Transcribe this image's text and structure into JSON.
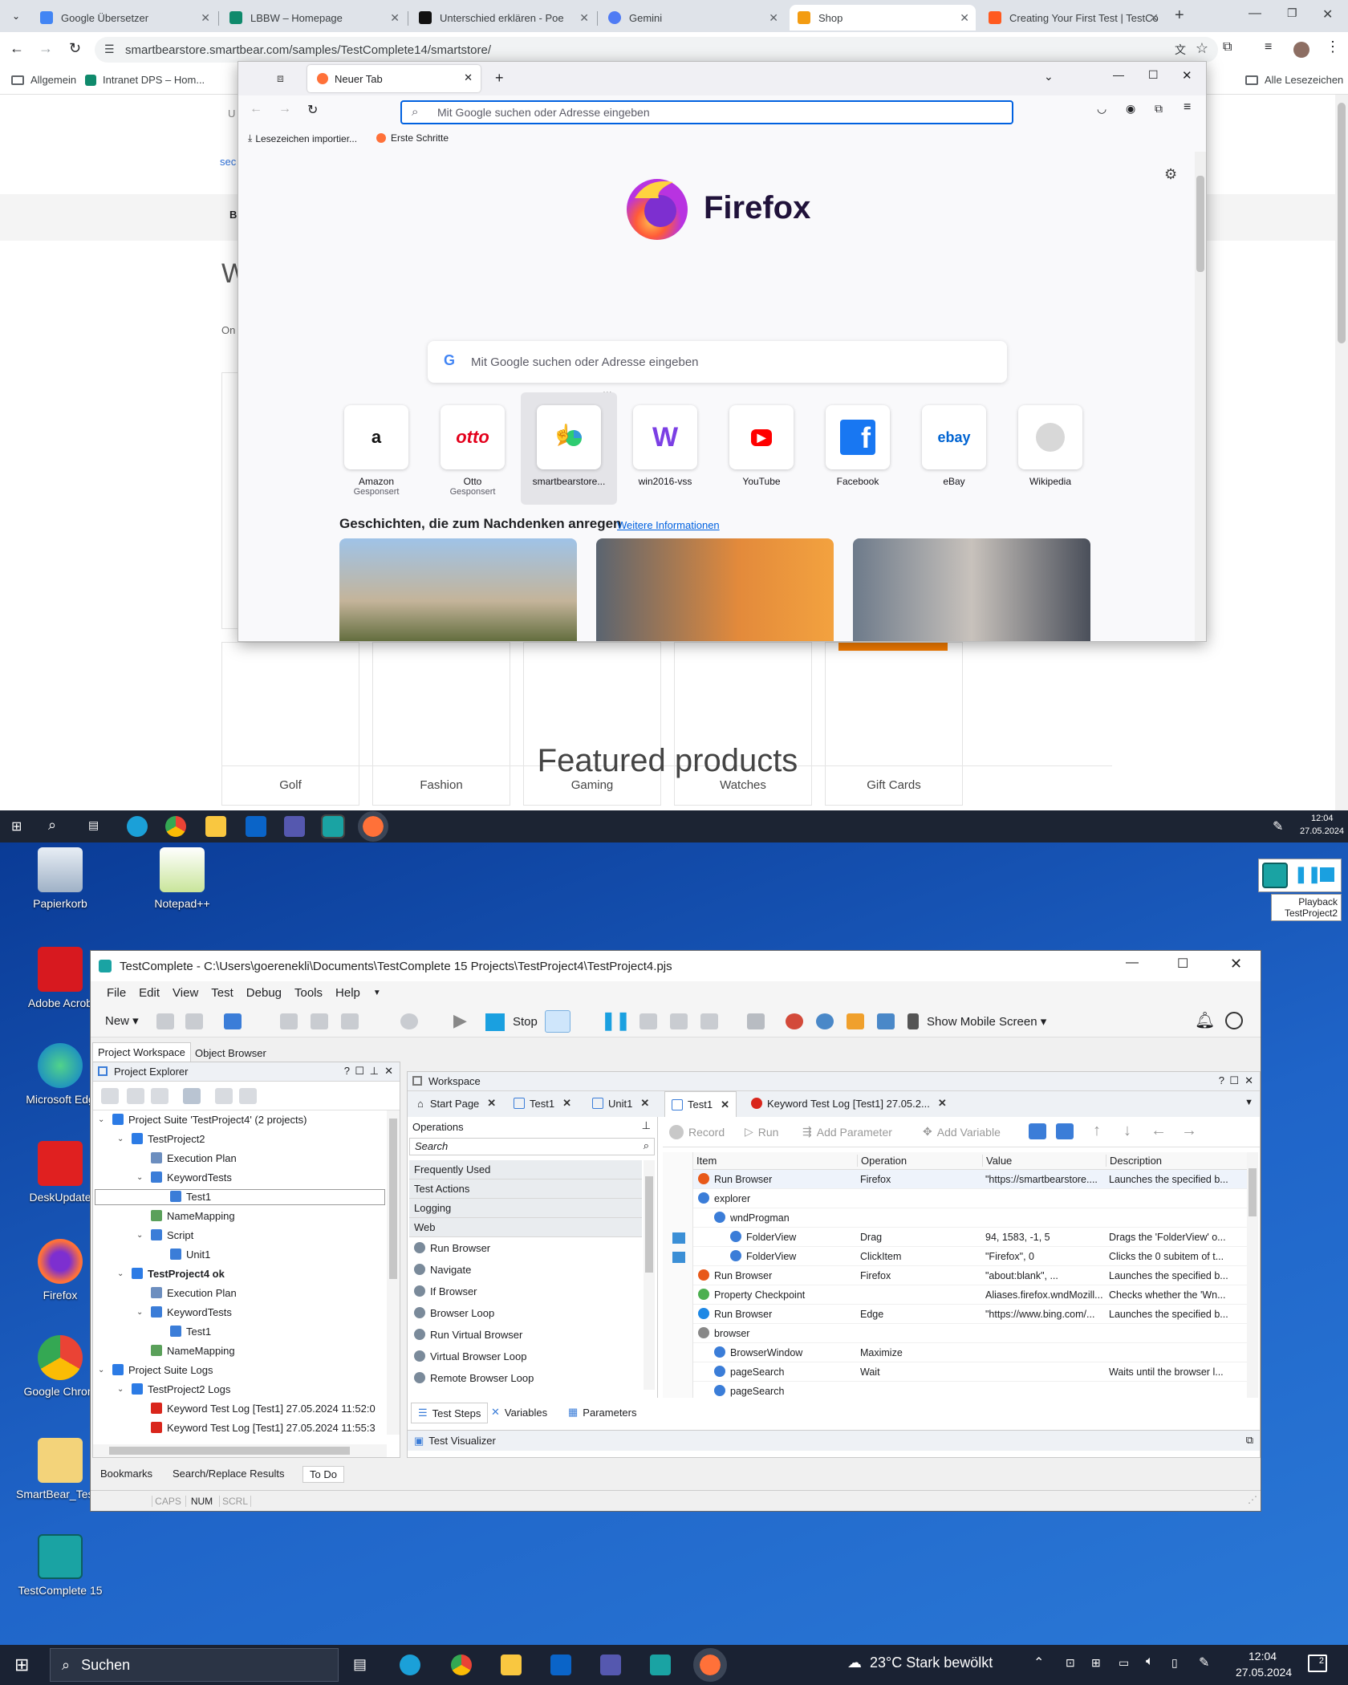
{
  "chrome": {
    "tabs": [
      {
        "label": "Google Übersetzer",
        "color": "#4285f4"
      },
      {
        "label": "LBBW – Homepage",
        "color": "#0f8a6c"
      },
      {
        "label": "Unterschied erklären - Poe",
        "color": "#111111"
      },
      {
        "label": "Gemini",
        "color": "#4f7bf4"
      },
      {
        "label": "Shop",
        "color": "#f39c12"
      },
      {
        "label": "Creating Your First Test | TestCo",
        "color": "#ff5a1f"
      }
    ],
    "url": "smartbearstore.smartbear.com/samples/TestComplete14/smartstore/",
    "bookmarks": [
      "Allgemein",
      "Intranet DPS – Hom..."
    ],
    "all_bookmarks": "Alle Lesezeichen"
  },
  "shop": {
    "partial_left": [
      "U",
      "sec",
      "B",
      "W",
      "On"
    ],
    "categories": [
      "Golf",
      "Fashion",
      "Gaming",
      "Watches",
      "Gift Cards"
    ],
    "featured": "Featured products"
  },
  "firefox": {
    "tab_label": "Neuer Tab",
    "address_placeholder": "Mit Google suchen oder Adresse eingeben",
    "bookmarks": [
      "Lesezeichen importier...",
      "Erste Schritte"
    ],
    "brand": "Firefox",
    "search_placeholder": "Mit Google suchen oder Adresse eingeben",
    "top_sites": [
      {
        "label": "Amazon",
        "sub": "Gesponsert",
        "glyph": "a",
        "color": "#111111"
      },
      {
        "label": "Otto",
        "sub": "Gesponsert",
        "glyph": "otto",
        "color": "#e3001b"
      },
      {
        "label": "smartbearstore...",
        "sub": "",
        "glyph": "",
        "color": "#f39c12"
      },
      {
        "label": "win2016-vss",
        "sub": "",
        "glyph": "W",
        "color": "#7b3fe4"
      },
      {
        "label": "YouTube",
        "sub": "",
        "glyph": "▶",
        "color": "#ff0000"
      },
      {
        "label": "Facebook",
        "sub": "",
        "glyph": "f",
        "color": "#1877f2"
      },
      {
        "label": "eBay",
        "sub": "",
        "glyph": "ebay",
        "color": "#0064d2"
      },
      {
        "label": "Wikipedia",
        "sub": "",
        "glyph": "W",
        "color": "#777777"
      }
    ],
    "stories_title": "Geschichten, die zum Nachdenken anregen",
    "stories_link": "Weitere Informationen",
    "menu_dots": "..."
  },
  "top_taskbar": {
    "time": "12:04",
    "date": "27.05.2024"
  },
  "desktop_icons": [
    "Papierkorb",
    "Notepad++",
    "Adobe Acrob",
    "Microsoft Edg",
    "DeskUpdate",
    "Firefox",
    "Google Chrom",
    "SmartBear_TestC",
    "TestComplete 15"
  ],
  "playback": {
    "line1": "Playback",
    "line2": "TestProject2"
  },
  "tc": {
    "title": "TestComplete - C:\\Users\\goerenekli\\Documents\\TestComplete 15 Projects\\TestProject4\\TestProject4.pjs",
    "menu": [
      "File",
      "Edit",
      "View",
      "Test",
      "Debug",
      "Tools",
      "Help"
    ],
    "toolbar": {
      "new": "New",
      "stop": "Stop",
      "mobile": "Show Mobile Screen"
    },
    "left_tabs": [
      "Project Workspace",
      "Object Browser"
    ],
    "explorer_title": "Project Explorer",
    "tree": [
      {
        "text": "Project Suite 'TestProject4' (2 projects)",
        "level": 0,
        "bold": false,
        "color": "#2c7be5"
      },
      {
        "text": "TestProject2",
        "level": 1,
        "bold": false,
        "color": "#2c7be5"
      },
      {
        "text": "Execution Plan",
        "level": 2,
        "bold": false,
        "color": "#6c8ebf"
      },
      {
        "text": "KeywordTests",
        "level": 2,
        "bold": false,
        "color": "#3b7dd8"
      },
      {
        "text": "Test1",
        "level": 3,
        "bold": false,
        "color": "#3b7dd8"
      },
      {
        "text": "NameMapping",
        "level": 2,
        "bold": false,
        "color": "#5aa05a"
      },
      {
        "text": "Script",
        "level": 2,
        "bold": false,
        "color": "#3b7dd8"
      },
      {
        "text": "Unit1",
        "level": 3,
        "bold": false,
        "color": "#3b7dd8"
      },
      {
        "text": "TestProject4 ok",
        "level": 1,
        "bold": true,
        "color": "#2c7be5"
      },
      {
        "text": "Execution Plan",
        "level": 2,
        "bold": false,
        "color": "#6c8ebf"
      },
      {
        "text": "KeywordTests",
        "level": 2,
        "bold": false,
        "color": "#3b7dd8"
      },
      {
        "text": "Test1",
        "level": 3,
        "bold": false,
        "color": "#3b7dd8"
      },
      {
        "text": "NameMapping",
        "level": 2,
        "bold": false,
        "color": "#5aa05a"
      },
      {
        "text": "Project Suite Logs",
        "level": 0,
        "bold": false,
        "color": "#2c7be5"
      },
      {
        "text": "TestProject2 Logs",
        "level": 1,
        "bold": false,
        "color": "#2c7be5"
      },
      {
        "text": "Keyword Test Log [Test1] 27.05.2024 11:52:0",
        "level": 2,
        "bold": false,
        "color": "#d9261c"
      },
      {
        "text": "Keyword Test Log [Test1] 27.05.2024 11:55:3",
        "level": 2,
        "bold": false,
        "color": "#d9261c"
      }
    ],
    "workspace_title": "Workspace",
    "workspace_tabs": [
      "Start Page",
      "Test1",
      "Unit1",
      "Test1",
      "Keyword Test Log [Test1] 27.05.2..."
    ],
    "operations_title": "Operations",
    "operations_search": "Search",
    "operations_sections": [
      "Frequently Used",
      "Test Actions",
      "Logging",
      "Web"
    ],
    "operations_items": [
      "Run Browser",
      "Navigate",
      "If Browser",
      "Browser Loop",
      "Run Virtual Browser",
      "Virtual Browser Loop",
      "Remote Browser Loop"
    ],
    "kw_toolbar": [
      "Record",
      "Run",
      "Add Parameter",
      "Add Variable"
    ],
    "grid_headers": [
      "Item",
      "Operation",
      "Value",
      "Description"
    ],
    "grid_rows": [
      {
        "item": "Run Browser",
        "level": 0,
        "op": "Firefox",
        "value": "\"https://smartbearstore....",
        "desc": "Launches the specified b...",
        "color": "#e8591a"
      },
      {
        "item": "explorer",
        "level": 0,
        "op": "",
        "value": "",
        "desc": "",
        "color": "#3b7dd8"
      },
      {
        "item": "wndProgman",
        "level": 1,
        "op": "",
        "value": "",
        "desc": "",
        "color": "#3b7dd8"
      },
      {
        "item": "FolderView",
        "level": 2,
        "op": "Drag",
        "value": "94, 1583, -1, 5",
        "desc": "Drags the 'FolderView' o...",
        "color": "#3b7dd8"
      },
      {
        "item": "FolderView",
        "level": 2,
        "op": "ClickItem",
        "value": "\"Firefox\", 0",
        "desc": "Clicks the 0 subitem of t...",
        "color": "#3b7dd8"
      },
      {
        "item": "Run Browser",
        "level": 0,
        "op": "Firefox",
        "value": "\"about:blank\", ...",
        "desc": "Launches the specified b...",
        "color": "#e8591a"
      },
      {
        "item": "Property Checkpoint",
        "level": 0,
        "op": "",
        "value": "Aliases.firefox.wndMozill...",
        "desc": "Checks whether the 'Wn...",
        "color": "#4caf50"
      },
      {
        "item": "Run Browser",
        "level": 0,
        "op": "Edge",
        "value": "\"https://www.bing.com/...",
        "desc": "Launches the specified b...",
        "color": "#1e88e5"
      },
      {
        "item": "browser",
        "level": 0,
        "op": "",
        "value": "",
        "desc": "",
        "color": "#888888"
      },
      {
        "item": "BrowserWindow",
        "level": 1,
        "op": "Maximize",
        "value": "",
        "desc": "",
        "color": "#3b7dd8"
      },
      {
        "item": "pageSearch",
        "level": 1,
        "op": "Wait",
        "value": "",
        "desc": "Waits until the browser l...",
        "color": "#3b7dd8"
      },
      {
        "item": "pageSearch",
        "level": 1,
        "op": "",
        "value": "",
        "desc": "",
        "color": "#3b7dd8"
      }
    ],
    "bottom_tabs": [
      "Test Steps",
      "Variables",
      "Parameters"
    ],
    "visualizer": "Test Visualizer",
    "footer_tabs": [
      "Bookmarks",
      "Search/Replace Results",
      "To Do"
    ],
    "status": [
      "CAPS",
      "NUM",
      "SCRL"
    ]
  },
  "taskbar": {
    "search": "Suchen",
    "weather": "23°C  Stark bewölkt",
    "time": "12:04",
    "date": "27.05.2024",
    "notif": "2"
  }
}
